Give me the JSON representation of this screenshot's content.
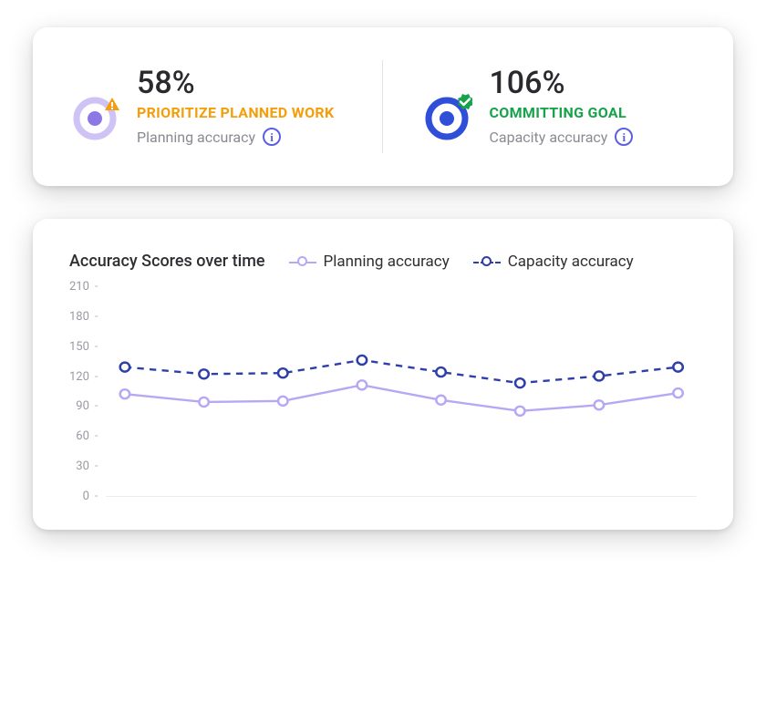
{
  "metrics": [
    {
      "value": "58%",
      "title": "PRIORITIZE PLANNED WORK",
      "sublabel": "Planning accuracy",
      "status": "warning",
      "icon": "target-warning-icon"
    },
    {
      "value": "106%",
      "title": "COMMITTING GOAL",
      "sublabel": "Capacity accuracy",
      "status": "success",
      "icon": "target-success-icon"
    }
  ],
  "chart": {
    "title": "Accuracy Scores over time",
    "legend": [
      {
        "label": "Planning accuracy",
        "color": "#b7a7f5",
        "style": "solid"
      },
      {
        "label": "Capacity accuracy",
        "color": "#2f3fa8",
        "style": "dashed"
      }
    ],
    "y_ticks": [
      "210",
      "180",
      "150",
      "120",
      "90",
      "60",
      "30",
      "0"
    ]
  },
  "chart_data": {
    "type": "line",
    "ylabel": "",
    "xlabel": "",
    "ylim": [
      0,
      210
    ],
    "x": [
      1,
      2,
      3,
      4,
      5,
      6,
      7,
      8
    ],
    "series": [
      {
        "name": "Planning accuracy",
        "values": [
          103,
          95,
          96,
          112,
          97,
          86,
          92,
          104
        ],
        "color": "#b7a7f5",
        "style": "solid"
      },
      {
        "name": "Capacity accuracy",
        "values": [
          130,
          123,
          124,
          137,
          125,
          114,
          121,
          130
        ],
        "color": "#2f3fa8",
        "style": "dashed"
      }
    ]
  },
  "colors": {
    "warning": "#f59e0b",
    "success": "#16a34a",
    "planning": "#b7a7f5",
    "capacity": "#2f3fa8"
  }
}
